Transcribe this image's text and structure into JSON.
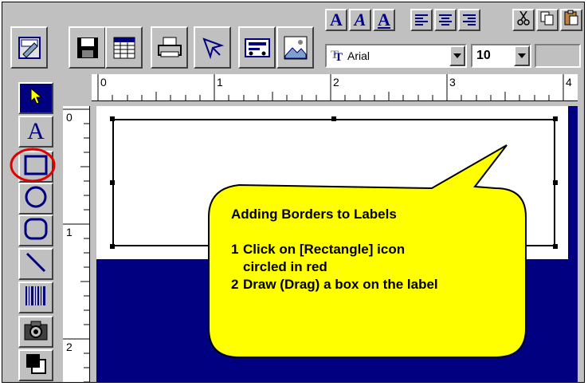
{
  "toolbar": {
    "buttons": [
      {
        "name": "label-properties-icon"
      },
      {
        "name": "save-icon"
      },
      {
        "name": "database-icon"
      },
      {
        "name": "print-icon"
      },
      {
        "name": "design-tool-icon"
      },
      {
        "name": "print-preview-icon"
      },
      {
        "name": "picture-icon"
      }
    ],
    "format": {
      "font_style_buttons": [
        "A",
        "A",
        "A"
      ],
      "font_name": "Arial",
      "font_size": "10"
    }
  },
  "tools": [
    {
      "name": "select-arrow-icon"
    },
    {
      "name": "text-tool-icon",
      "glyph": "A"
    },
    {
      "name": "rectangle-tool-icon",
      "highlighted": true
    },
    {
      "name": "ellipse-tool-icon"
    },
    {
      "name": "rounded-rectangle-tool-icon"
    },
    {
      "name": "line-tool-icon"
    },
    {
      "name": "barcode-tool-icon"
    },
    {
      "name": "camera-tool-icon"
    },
    {
      "name": "color-tool-icon"
    }
  ],
  "ruler": {
    "horizontal": [
      "0",
      "1",
      "2",
      "3",
      "4"
    ],
    "vertical": [
      "0",
      "1",
      "2"
    ]
  },
  "callout": {
    "title": "Adding Borders to Labels",
    "steps": [
      {
        "num": "1",
        "text": "Click on [Rectangle] icon circled in red"
      },
      {
        "num": "2",
        "text": "Draw (Drag) a box on the label"
      }
    ],
    "fill_color": "#ffff00",
    "circle_color": "#e00000"
  }
}
